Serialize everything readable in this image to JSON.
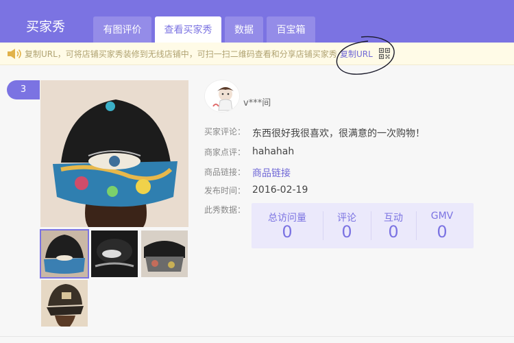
{
  "header": {
    "brand": "买家秀",
    "tabs": [
      {
        "label": "有图评价",
        "active": false
      },
      {
        "label": "查看买家秀",
        "active": true
      },
      {
        "label": "数据",
        "active": false
      },
      {
        "label": "百宝箱",
        "active": false
      }
    ]
  },
  "notice": {
    "text": "复制URL，可将店铺买家秀装修到无线店铺中，可扫一扫二维码查看和分享店铺买家秀",
    "copy_label": "复制URL",
    "icons": [
      "speaker-icon",
      "qr-code-icon"
    ]
  },
  "post": {
    "index": "3",
    "user": "v***间",
    "fields": [
      {
        "label": "买家评论：",
        "value": "东西很好我很喜欢，很满意的一次购物！"
      },
      {
        "label": "商家点评：",
        "value": "hahahah"
      },
      {
        "label": "商品链接：",
        "value": "商品链接"
      },
      {
        "label": "发布时间：",
        "value": "2016-02-19"
      },
      {
        "label": "此秀数据："
      }
    ],
    "stats": [
      {
        "label": "总访问量",
        "value": "0"
      },
      {
        "label": "评论",
        "value": "0"
      },
      {
        "label": "互动",
        "value": "0"
      },
      {
        "label": "GMV",
        "value": "0"
      }
    ]
  },
  "colors": {
    "accent": "#7b73e2",
    "notice_bg": "#fffbe7",
    "stats_bg": "#ebe9fb"
  }
}
